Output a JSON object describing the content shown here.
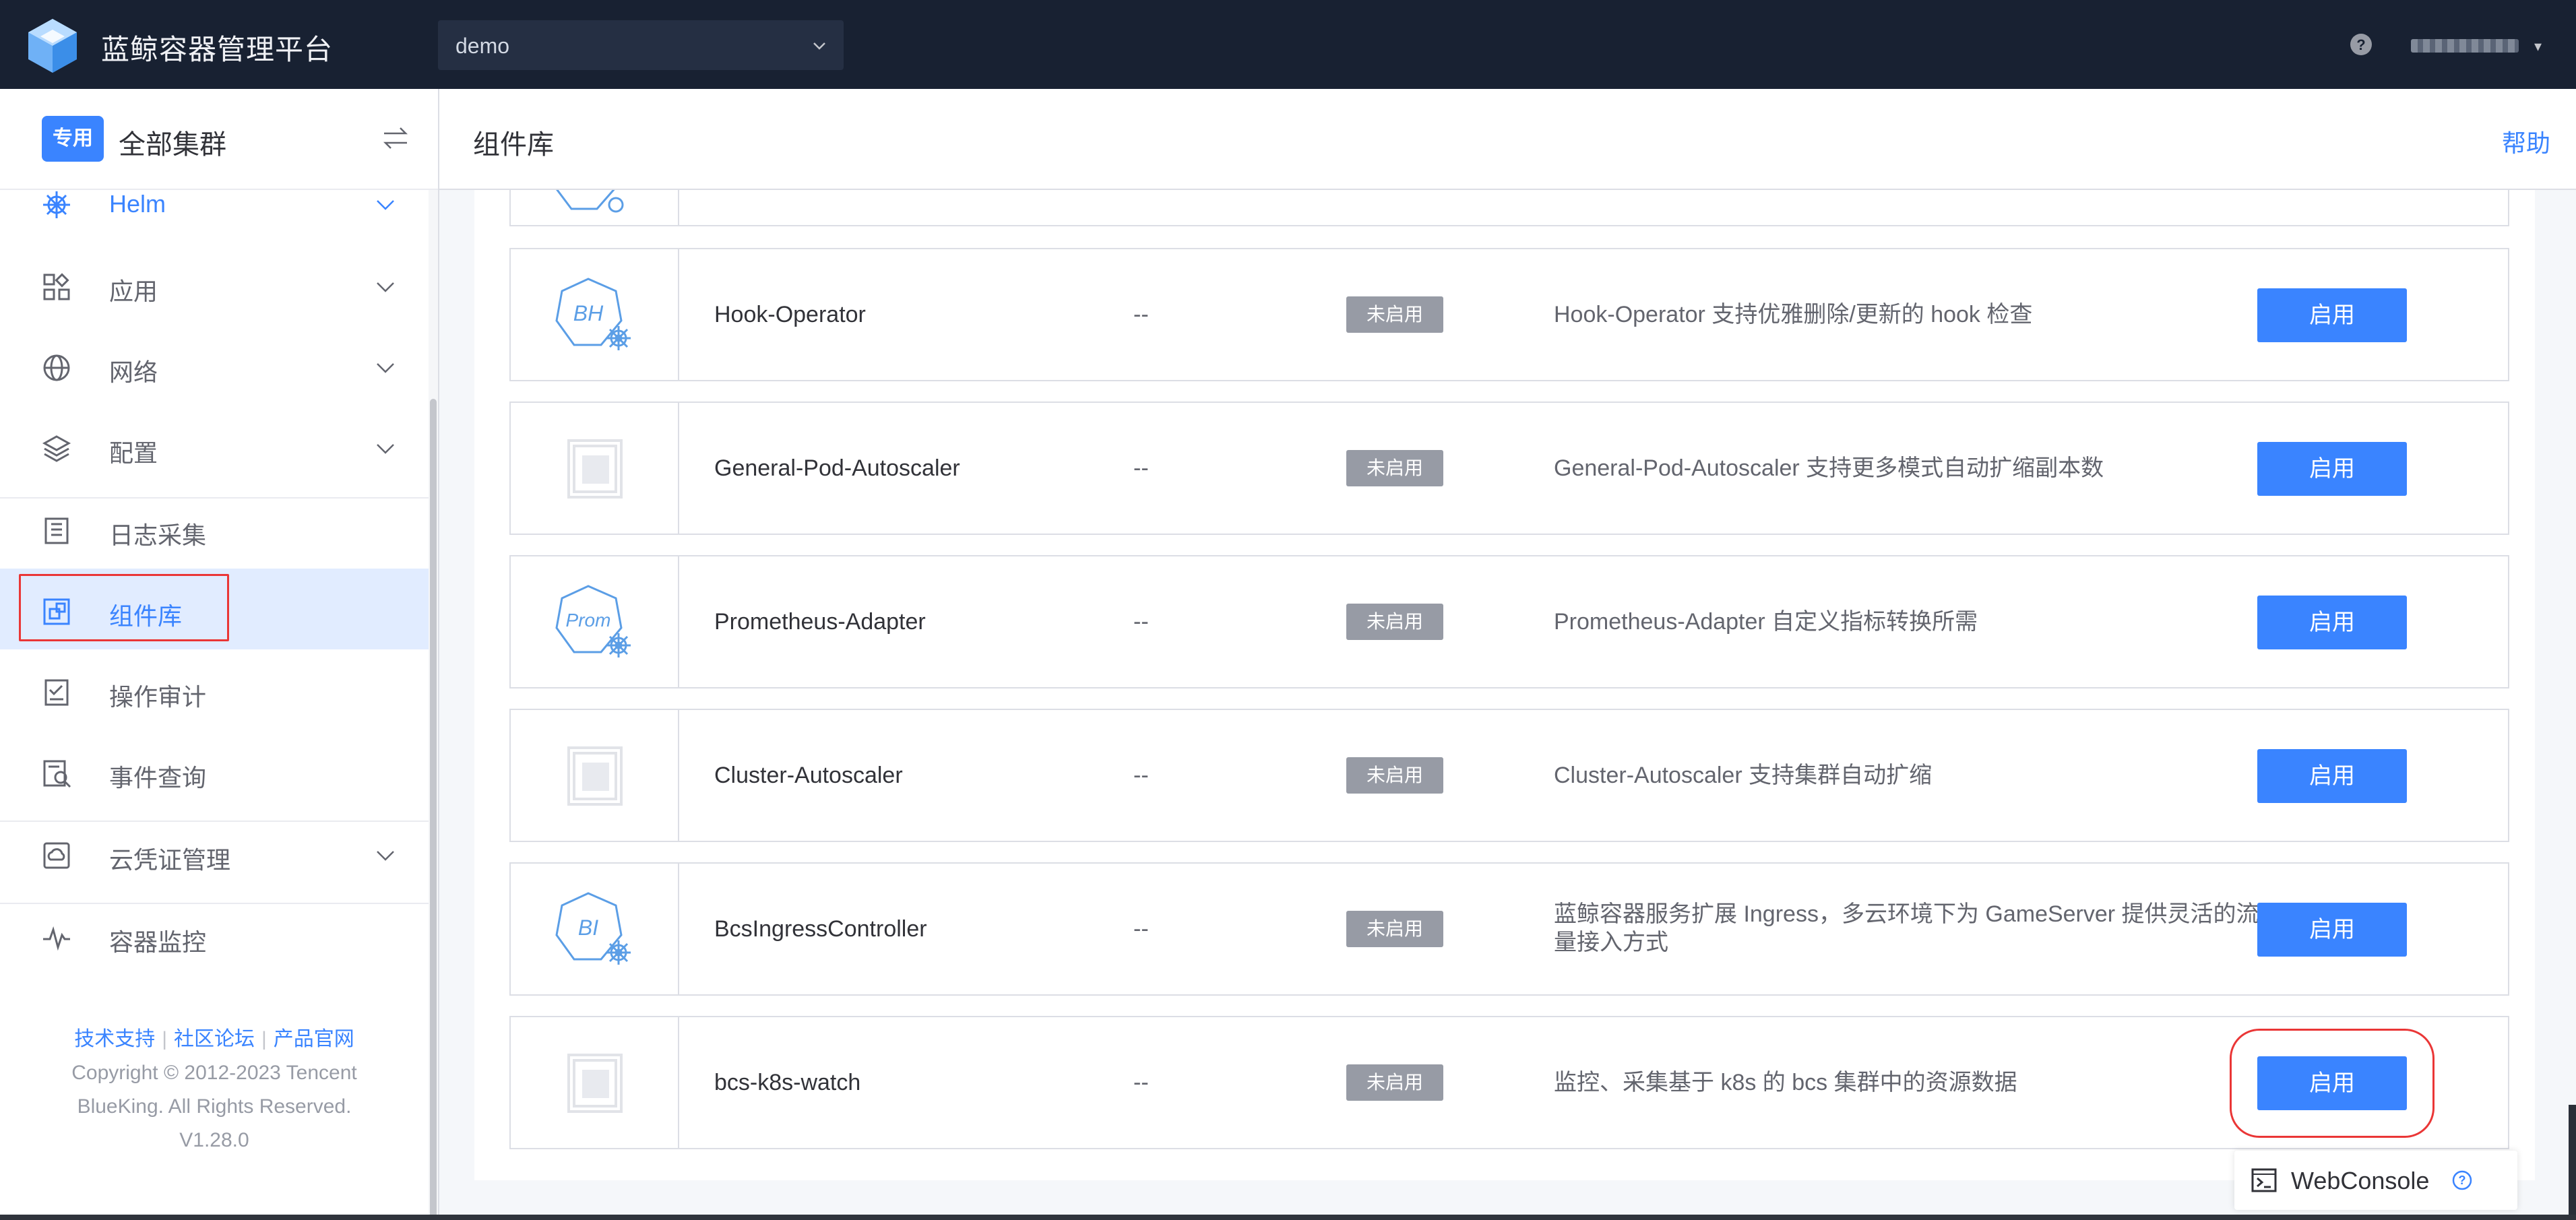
{
  "app": {
    "title": "蓝鲸容器管理平台",
    "project": "demo"
  },
  "cluster": {
    "badge": "专用",
    "name": "全部集群"
  },
  "nav": {
    "helm": "Helm",
    "app": "应用",
    "network": "网络",
    "config": "配置",
    "logs": "日志采集",
    "components": "组件库",
    "audit": "操作审计",
    "events": "事件查询",
    "cloud_cred": "云凭证管理",
    "monitor": "容器监控"
  },
  "footer": {
    "link_support": "技术支持",
    "link_forum": "社区论坛",
    "link_site": "产品官网",
    "copyright": "Copyright © 2012-2023 Tencent BlueKing. All Rights Reserved.",
    "version": "V1.28.0"
  },
  "header": {
    "title": "组件库",
    "help": "帮助"
  },
  "components": [
    {
      "icon_text": "BH",
      "icon": "helm-component-icon",
      "name": "Hook-Operator",
      "version": "--",
      "status": "未启用",
      "desc": "Hook-Operator 支持优雅删除/更新的 hook 检查",
      "action": "启用"
    },
    {
      "icon_text": "",
      "icon": "placeholder-component-icon",
      "name": "General-Pod-Autoscaler",
      "version": "--",
      "status": "未启用",
      "desc": "General-Pod-Autoscaler 支持更多模式自动扩缩副本数",
      "action": "启用"
    },
    {
      "icon_text": "Prom",
      "icon": "helm-component-icon",
      "name": "Prometheus-Adapter",
      "version": "--",
      "status": "未启用",
      "desc": "Prometheus-Adapter 自定义指标转换所需",
      "action": "启用"
    },
    {
      "icon_text": "",
      "icon": "placeholder-component-icon",
      "name": "Cluster-Autoscaler",
      "version": "--",
      "status": "未启用",
      "desc": "Cluster-Autoscaler 支持集群自动扩缩",
      "action": "启用"
    },
    {
      "icon_text": "BI",
      "icon": "helm-component-icon",
      "name": "BcsIngressController",
      "version": "--",
      "status": "未启用",
      "desc": "蓝鲸容器服务扩展 Ingress，多云环境下为 GameServer 提供灵活的流量接入方式",
      "action": "启用"
    },
    {
      "icon_text": "",
      "icon": "placeholder-component-icon",
      "name": "bcs-k8s-watch",
      "version": "--",
      "status": "未启用",
      "desc": "监控、采集基于 k8s 的 bcs 集群中的资源数据",
      "action": "启用"
    }
  ],
  "webconsole": {
    "label": "WebConsole"
  },
  "colors": {
    "topbar": "#182132",
    "accent": "#3a84ff",
    "status_gray": "#979ba5",
    "highlight": "#ea3636"
  }
}
